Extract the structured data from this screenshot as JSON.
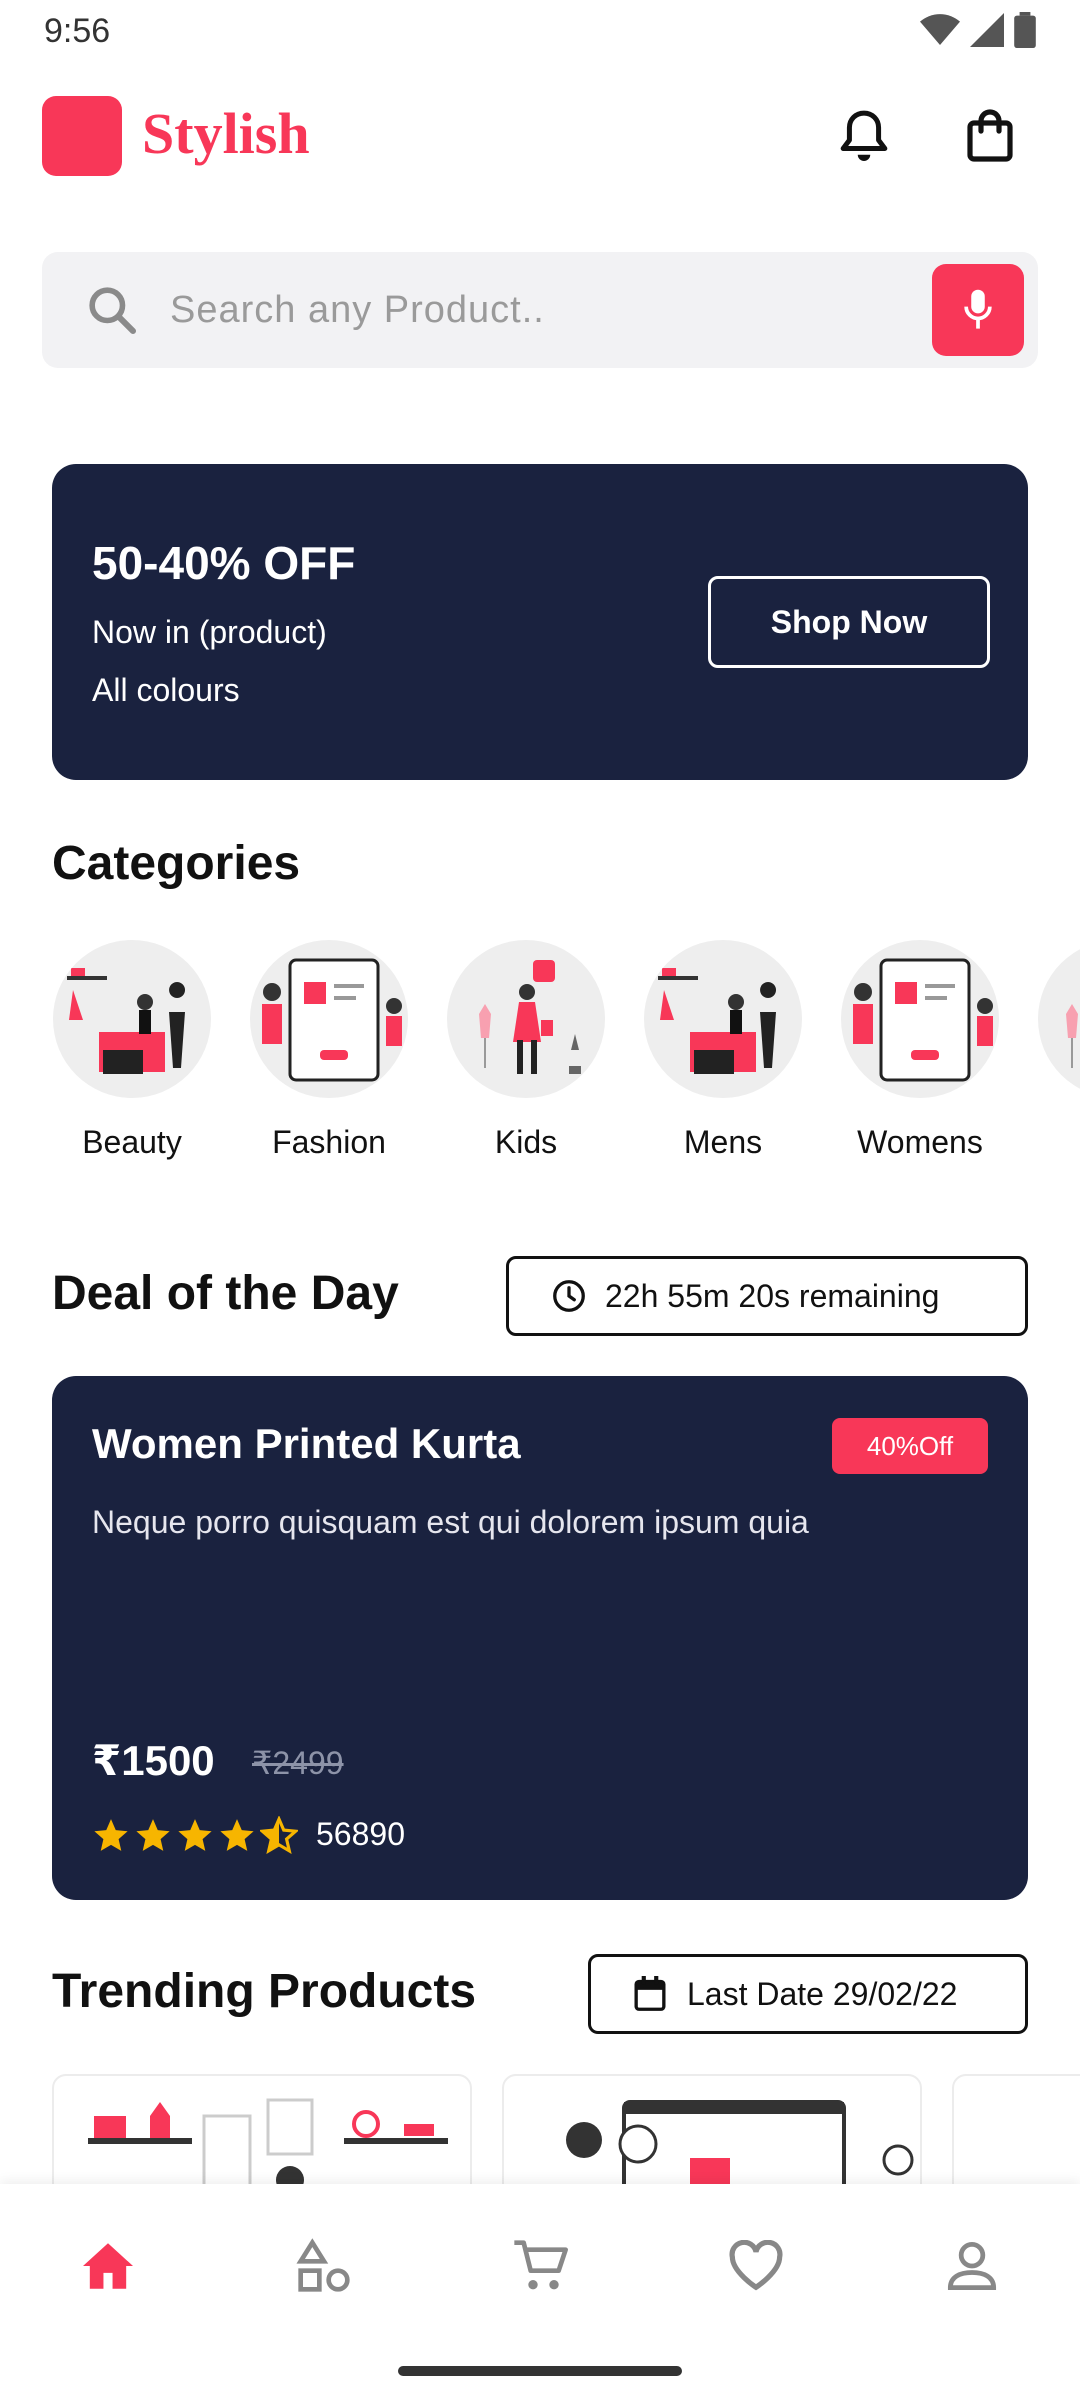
{
  "status_bar": {
    "time": "9:56",
    "icons": [
      "wifi-icon",
      "signal-icon",
      "battery-icon"
    ]
  },
  "header": {
    "brand": "Stylish",
    "icons": [
      "bell-icon",
      "shopping-bag-icon"
    ]
  },
  "search": {
    "placeholder": "Search any Product..",
    "icons": [
      "search-icon",
      "mic-icon"
    ]
  },
  "promo": {
    "title": "50-40% OFF",
    "line1": "Now in (product)",
    "line2": "All colours",
    "button": "Shop Now"
  },
  "categories": {
    "title": "Categories",
    "items": [
      {
        "label": "Beauty"
      },
      {
        "label": "Fashion"
      },
      {
        "label": "Kids"
      },
      {
        "label": "Mens"
      },
      {
        "label": "Womens"
      }
    ]
  },
  "deal": {
    "title": "Deal of the Day",
    "timer": "22h 55m 20s remaining",
    "product": {
      "name": "Women Printed Kurta",
      "badge": "40%Off",
      "description": "Neque porro quisquam est qui dolorem ipsum quia",
      "price": "₹1500",
      "old_price": "₹2499",
      "rating": 4.5,
      "reviews": "56890"
    }
  },
  "trending": {
    "title": "Trending Products",
    "last_date": "Last Date 29/02/22"
  },
  "bottom_nav": {
    "items": [
      {
        "icon": "home-icon",
        "active": true
      },
      {
        "icon": "categories-icon",
        "active": false
      },
      {
        "icon": "cart-icon",
        "active": false
      },
      {
        "icon": "heart-icon",
        "active": false
      },
      {
        "icon": "profile-icon",
        "active": false
      }
    ]
  },
  "colors": {
    "accent": "#F83758",
    "dark": "#1A223F",
    "star": "#F7B500"
  }
}
